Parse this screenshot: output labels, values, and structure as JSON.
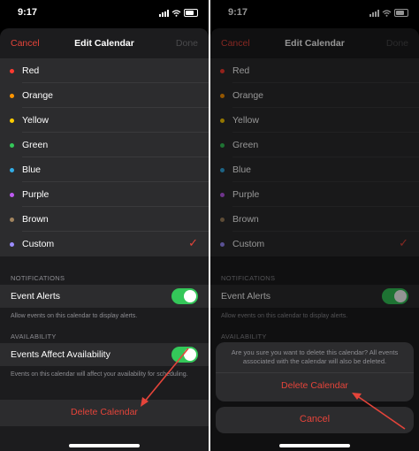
{
  "status": {
    "time": "9:17"
  },
  "nav": {
    "cancel": "Cancel",
    "title": "Edit Calendar",
    "done": "Done"
  },
  "colors_list": [
    {
      "label": "Red",
      "color": "#ff3b30"
    },
    {
      "label": "Orange",
      "color": "#ff9500"
    },
    {
      "label": "Yellow",
      "color": "#ffcc00"
    },
    {
      "label": "Green",
      "color": "#34c759"
    },
    {
      "label": "Blue",
      "color": "#32ade6"
    },
    {
      "label": "Purple",
      "color": "#bf5af2"
    },
    {
      "label": "Brown",
      "color": "#a2845e"
    },
    {
      "label": "Custom",
      "color": "#9b8cff",
      "selected": true
    }
  ],
  "check": "✓",
  "notifications": {
    "header": "NOTIFICATIONS",
    "event_alerts": "Event Alerts",
    "event_alerts_on": true,
    "note": "Allow events on this calendar to display alerts."
  },
  "availability": {
    "header": "AVAILABILITY",
    "events_affect": "Events Affect Availability",
    "events_affect_on": true,
    "note": "Events on this calendar will affect your availability for scheduling."
  },
  "delete_label": "Delete Calendar",
  "action_sheet": {
    "message": "Are you sure you want to delete this calendar? All events associated with the calendar will also be deleted.",
    "delete": "Delete Calendar",
    "cancel": "Cancel"
  },
  "accent": "#e5443a",
  "annotation_arrow_color": "#e5443a"
}
